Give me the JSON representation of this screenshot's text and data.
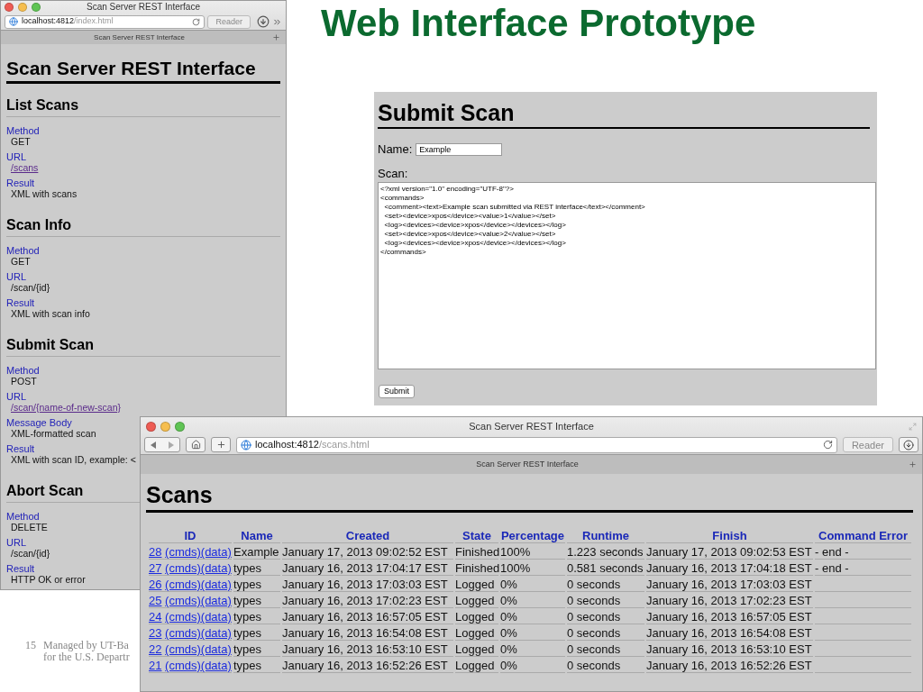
{
  "slide": {
    "title": "Web Interface Prototype",
    "footer": {
      "page": "15",
      "lines": [
        "Managed by UT-Ba",
        "for the U.S. Departr"
      ]
    }
  },
  "index_window": {
    "title": "Scan Server REST Interface",
    "url_host": "localhost:4812",
    "url_path": "/index.html",
    "reader": "Reader",
    "tab": "Scan Server REST Interface",
    "heading": "Scan Server REST Interface",
    "sections": [
      {
        "title": "List Scans",
        "fields": [
          {
            "label": "Method",
            "value": "GET",
            "link": false
          },
          {
            "label": "URL",
            "value": "/scans",
            "link": true
          },
          {
            "label": "Result",
            "value": "XML with scans",
            "link": false
          }
        ]
      },
      {
        "title": "Scan Info",
        "fields": [
          {
            "label": "Method",
            "value": "GET",
            "link": false
          },
          {
            "label": "URL",
            "value": "/scan/{id}",
            "link": false
          },
          {
            "label": "Result",
            "value": "XML with scan info",
            "link": false
          }
        ]
      },
      {
        "title": "Submit Scan",
        "fields": [
          {
            "label": "Method",
            "value": "POST",
            "link": false
          },
          {
            "label": "URL",
            "value": "/scan/{name-of-new-scan}",
            "link": true
          },
          {
            "label": "Message Body",
            "value": "XML-formatted scan",
            "link": false
          },
          {
            "label": "Result",
            "value": "XML with scan ID, example: <",
            "link": false
          }
        ]
      },
      {
        "title": "Abort Scan",
        "fields": [
          {
            "label": "Method",
            "value": "DELETE",
            "link": false
          },
          {
            "label": "URL",
            "value": "/scan/{id}",
            "link": false
          },
          {
            "label": "Result",
            "value": "HTTP OK or error",
            "link": false
          }
        ]
      }
    ]
  },
  "submit_form": {
    "heading": "Submit Scan",
    "name_label": "Name:",
    "name_value": "Example",
    "scan_label": "Scan:",
    "scan_value": "<?xml version=\"1.0\" encoding=\"UTF-8\"?>\n<commands>\n  <comment><text>Example scan submitted via REST interface</text></comment>\n  <set><device>xpos</device><value>1</value></set>\n  <log><devices><device>xpos</device></devices></log>\n  <set><device>xpos</device><value>2</value></set>\n  <log><devices><device>xpos</device></devices></log>\n</commands>",
    "button": "Submit"
  },
  "scans_window": {
    "title": "Scan Server REST Interface",
    "url_host": "localhost:4812",
    "url_path": "/scans.html",
    "reader": "Reader",
    "tab": "Scan Server REST Interface",
    "heading": "Scans",
    "columns": [
      "ID",
      "Name",
      "Created",
      "State",
      "Percentage",
      "Runtime",
      "Finish",
      "Command Error"
    ],
    "rows": [
      {
        "id": "28",
        "cmds": "(cmds)",
        "data": "(data)",
        "name": "Example",
        "created": "January 17, 2013 09:02:52 EST",
        "state": "Finished",
        "percentage": "100%",
        "runtime": "1.223 seconds",
        "finish": "January 17, 2013 09:02:53 EST",
        "command_error": "- end -"
      },
      {
        "id": "27",
        "cmds": "(cmds)",
        "data": "(data)",
        "name": "types",
        "created": "January 16, 2013 17:04:17 EST",
        "state": "Finished",
        "percentage": "100%",
        "runtime": "0.581 seconds",
        "finish": "January 16, 2013 17:04:18 EST",
        "command_error": "- end -"
      },
      {
        "id": "26",
        "cmds": "(cmds)",
        "data": "(data)",
        "name": "types",
        "created": "January 16, 2013 17:03:03 EST",
        "state": "Logged",
        "percentage": "0%",
        "runtime": "0 seconds",
        "finish": "January 16, 2013 17:03:03 EST"
      },
      {
        "id": "25",
        "cmds": "(cmds)",
        "data": "(data)",
        "name": "types",
        "created": "January 16, 2013 17:02:23 EST",
        "state": "Logged",
        "percentage": "0%",
        "runtime": "0 seconds",
        "finish": "January 16, 2013 17:02:23 EST"
      },
      {
        "id": "24",
        "cmds": "(cmds)",
        "data": "(data)",
        "name": "types",
        "created": "January 16, 2013 16:57:05 EST",
        "state": "Logged",
        "percentage": "0%",
        "runtime": "0 seconds",
        "finish": "January 16, 2013 16:57:05 EST"
      },
      {
        "id": "23",
        "cmds": "(cmds)",
        "data": "(data)",
        "name": "types",
        "created": "January 16, 2013 16:54:08 EST",
        "state": "Logged",
        "percentage": "0%",
        "runtime": "0 seconds",
        "finish": "January 16, 2013 16:54:08 EST"
      },
      {
        "id": "22",
        "cmds": "(cmds)",
        "data": "(data)",
        "name": "types",
        "created": "January 16, 2013 16:53:10 EST",
        "state": "Logged",
        "percentage": "0%",
        "runtime": "0 seconds",
        "finish": "January 16, 2013 16:53:10 EST"
      },
      {
        "id": "21",
        "cmds": "(cmds)",
        "data": "(data)",
        "name": "types",
        "created": "January 16, 2013 16:52:26 EST",
        "state": "Logged",
        "percentage": "0%",
        "runtime": "0 seconds",
        "finish": "January 16, 2013 16:52:26 EST"
      }
    ]
  }
}
